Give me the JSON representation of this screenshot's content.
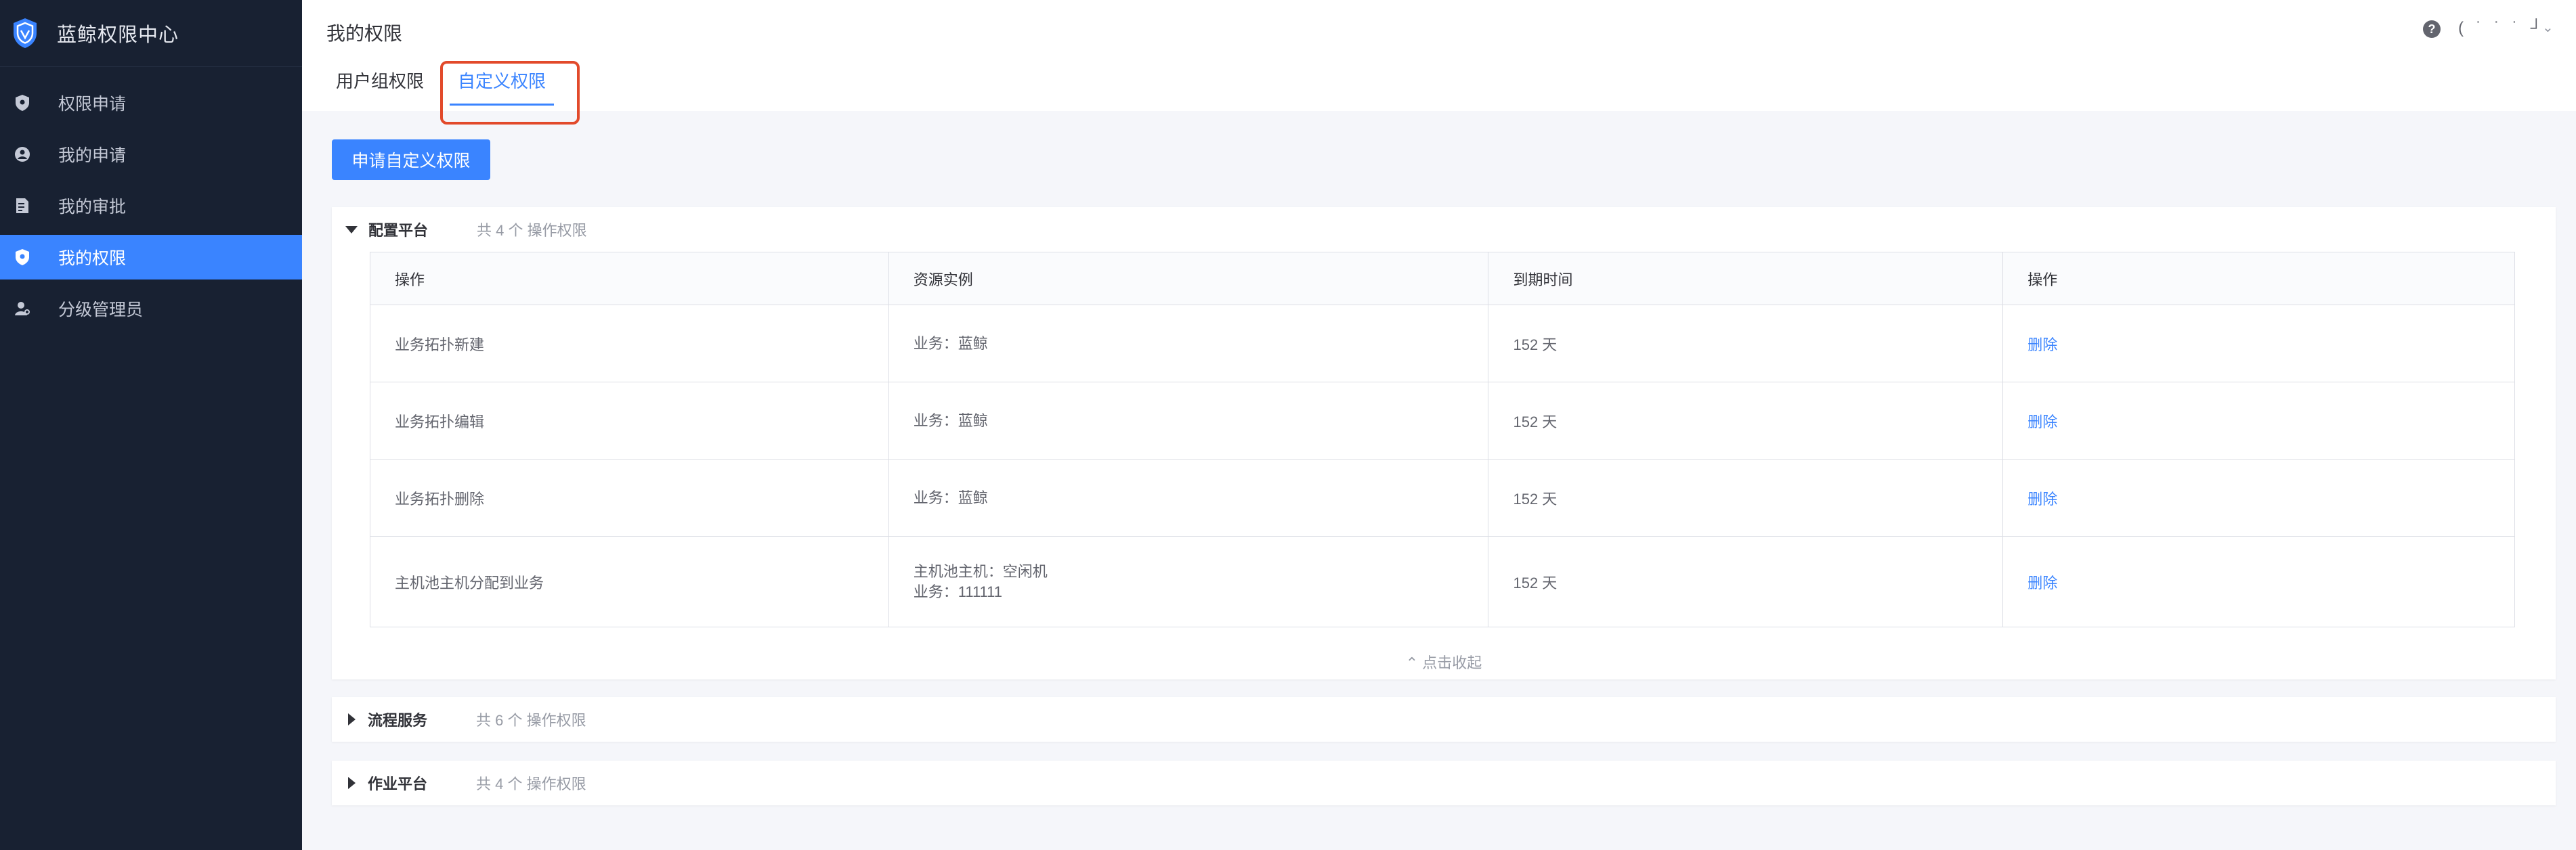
{
  "app": {
    "title": "蓝鲸权限中心"
  },
  "sidebar": {
    "items": [
      {
        "label": "权限申请",
        "icon": "shield-icon"
      },
      {
        "label": "我的申请",
        "icon": "user-circle-icon"
      },
      {
        "label": "我的审批",
        "icon": "document-edit-icon"
      },
      {
        "label": "我的权限",
        "icon": "shield-icon",
        "active": true
      },
      {
        "label": "分级管理员",
        "icon": "user-admin-icon"
      }
    ]
  },
  "header": {
    "title": "我的权限",
    "username": "( ˙ ˙ ˙ ┘",
    "tabs": [
      {
        "label": "用户组权限"
      },
      {
        "label": "自定义权限",
        "active": true
      }
    ]
  },
  "apply_button": "申请自定义权限",
  "table_headers": {
    "action": "操作",
    "resource": "资源实例",
    "expire": "到期时间",
    "op": "操作"
  },
  "systems": [
    {
      "name": "配置平台",
      "count": "共 4 个 操作权限",
      "expanded": true,
      "rows": [
        {
          "action": "业务拓扑新建",
          "resource": [
            "业务：蓝鲸"
          ],
          "expire": "152 天",
          "op": "删除"
        },
        {
          "action": "业务拓扑编辑",
          "resource": [
            "业务：蓝鲸"
          ],
          "expire": "152 天",
          "op": "删除"
        },
        {
          "action": "业务拓扑删除",
          "resource": [
            "业务：蓝鲸"
          ],
          "expire": "152 天",
          "op": "删除"
        },
        {
          "action": "主机池主机分配到业务",
          "resource": [
            "主机池主机：空闲机",
            "业务：111111"
          ],
          "expire": "152 天",
          "op": "删除"
        }
      ],
      "collapse_label": "点击收起"
    },
    {
      "name": "流程服务",
      "count": "共 6 个 操作权限",
      "expanded": false
    },
    {
      "name": "作业平台",
      "count": "共 4 个 操作权限",
      "expanded": false
    }
  ],
  "colors": {
    "sidebar_bg": "#182132",
    "accent": "#3a84ff",
    "highlight": "#e24a2b"
  }
}
